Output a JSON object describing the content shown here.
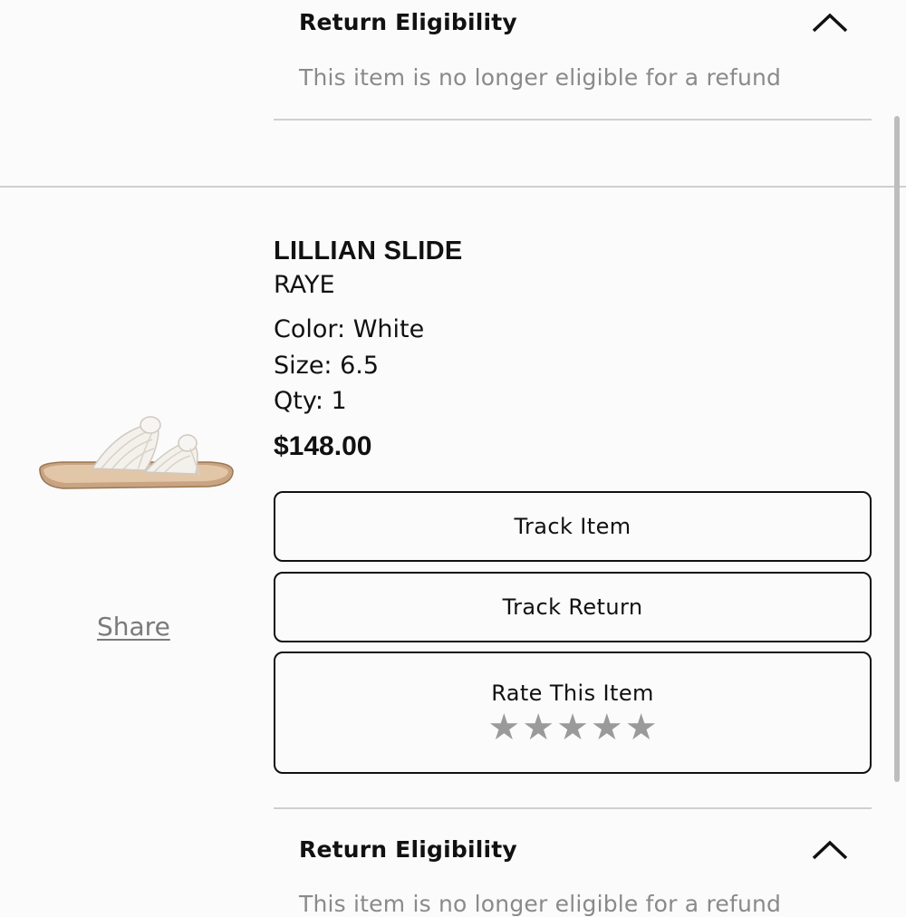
{
  "return_eligibility_top": {
    "title": "Return Eligibility",
    "message": "This item is no longer eligible for a refund"
  },
  "product": {
    "name": "LILLIAN SLIDE",
    "brand": "RAYE",
    "color": "Color: White",
    "size": "Size: 6.5",
    "qty": "Qty: 1",
    "price": "$148.00",
    "image_alt": "sandal-product-image",
    "share_label": "Share"
  },
  "actions": {
    "track_item": "Track Item",
    "track_return": "Track Return",
    "rate_item": "Rate This Item",
    "stars": [
      "★",
      "★",
      "★",
      "★",
      "★"
    ],
    "rating_value": 0
  },
  "return_eligibility_bottom": {
    "title": "Return Eligibility",
    "message": "This item is no longer eligible for a refund"
  },
  "icons": {
    "collapse": "chevron-up-icon",
    "star": "star-icon"
  },
  "colors": {
    "text": "#111111",
    "muted": "#8a8a8a",
    "star": "#9a9a9a",
    "divider": "#cfcfcf"
  }
}
